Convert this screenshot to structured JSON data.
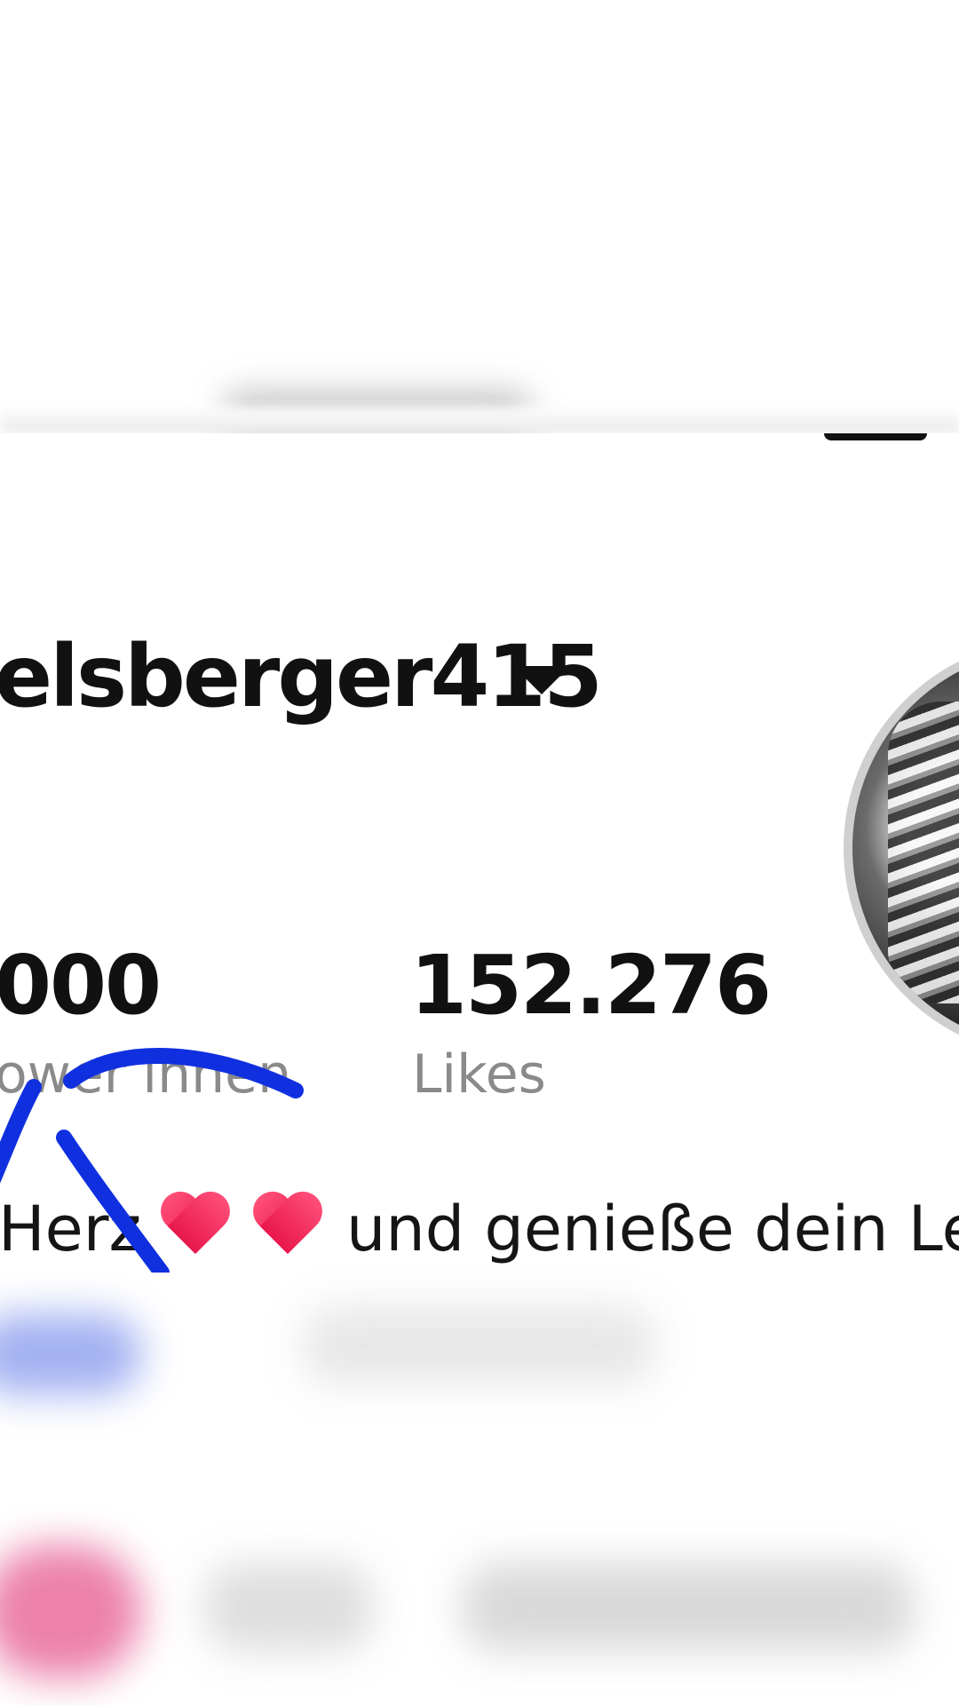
{
  "profile": {
    "username_partial": "elsberger415",
    "stats": [
      {
        "value": "000",
        "label": "ower innen"
      },
      {
        "value": "152.276",
        "label": "Likes"
      }
    ],
    "bio_start": "Herz",
    "bio_end": " und genieße dein Leb"
  },
  "colors": {
    "scribble": "#1030e0",
    "heart": "#ef2a58",
    "label_gray": "#8a8a8a"
  },
  "icons": [
    "menu-icon",
    "caret-down-icon",
    "heart-icon",
    "avatar"
  ]
}
